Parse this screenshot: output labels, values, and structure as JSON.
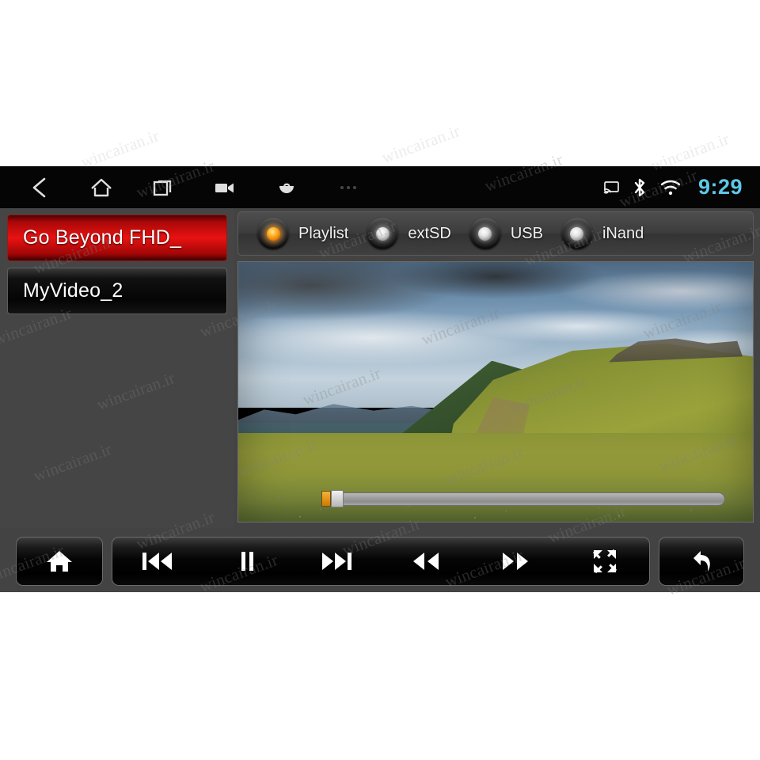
{
  "statusbar": {
    "nav": [
      {
        "name": "back-nav-icon",
        "label": "Back"
      },
      {
        "name": "home-nav-icon",
        "label": "Home"
      },
      {
        "name": "recents-nav-icon",
        "label": "Recent apps"
      },
      {
        "name": "screenshot-nav-icon",
        "label": "Screen record"
      },
      {
        "name": "apps-nav-icon",
        "label": "Apps"
      },
      {
        "name": "overflow-nav-icon",
        "label": "More"
      }
    ],
    "indicators": [
      {
        "name": "cast-icon",
        "label": "Cast"
      },
      {
        "name": "bluetooth-icon",
        "label": "Bluetooth"
      },
      {
        "name": "wifi-icon",
        "label": "Wi-Fi"
      }
    ],
    "time": "9:29",
    "time_color": "#5ec8e8"
  },
  "playlist": {
    "items": [
      {
        "title": "Go Beyond FHD_",
        "selected": true
      },
      {
        "title": "MyVideo_2",
        "selected": false
      }
    ],
    "selected_color": "#e81212"
  },
  "sources": {
    "options": [
      {
        "label": "Playlist",
        "active": true
      },
      {
        "label": "extSD",
        "active": false
      },
      {
        "label": "USB",
        "active": false
      },
      {
        "label": "iNand",
        "active": false
      }
    ],
    "active_led_color": "#ffb422",
    "inactive_led_color": "#e2e2e2"
  },
  "video": {
    "scene": "mountain landscape with clouds and green hillside meadow",
    "seek": {
      "progress_percent": 2,
      "fill_color": "#e6951a",
      "track_color": "#9e9e9e"
    }
  },
  "controls": {
    "home": {
      "label": "Home",
      "icon": "home-icon"
    },
    "transport": [
      {
        "label": "Previous",
        "icon": "previous-track-icon"
      },
      {
        "label": "Pause",
        "icon": "pause-icon"
      },
      {
        "label": "Next",
        "icon": "next-track-icon"
      },
      {
        "label": "Rewind",
        "icon": "rewind-icon"
      },
      {
        "label": "Fast forward",
        "icon": "fast-forward-icon"
      },
      {
        "label": "Fullscreen",
        "icon": "fullscreen-icon"
      }
    ],
    "back": {
      "label": "Back",
      "icon": "return-arrow-icon"
    }
  },
  "watermark": {
    "text": "wincairan.ir"
  }
}
